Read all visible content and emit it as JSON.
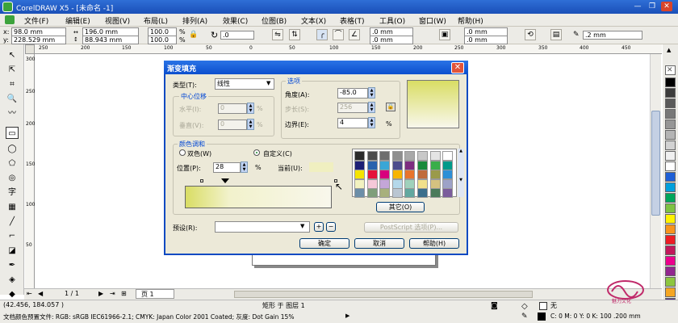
{
  "window": {
    "title": "CorelDRAW X5 - [未命名 -1]"
  },
  "menu": [
    "文件(F)",
    "编辑(E)",
    "视图(V)",
    "布局(L)",
    "排列(A)",
    "效果(C)",
    "位图(B)",
    "文本(X)",
    "表格(T)",
    "工具(O)",
    "窗口(W)",
    "帮助(H)"
  ],
  "propbar": {
    "x_label": "x:",
    "x": "98.0 mm",
    "y_label": "y:",
    "y": "228.529 mm",
    "w": "196.0 mm",
    "h": "88.943 mm",
    "sx": "100.0",
    "sy": "100.0",
    "pct": "%",
    "rot": ".0",
    "c1": ".0 mm",
    "c2": ".0 mm",
    "c3": ".0 mm",
    "c4": ".0 mm",
    "outline": ".2 mm"
  },
  "dialog": {
    "title": "渐变填充",
    "type_label": "类型(T):",
    "type_value": "线性",
    "options_label": "选项",
    "angle_label": "角度(A):",
    "angle": "-85.0",
    "steps_label": "步长(S):",
    "steps": "256",
    "edge_label": "边界(E):",
    "edge": "4",
    "pct": "%",
    "center_label": "中心位移",
    "hoz_label": "水平(I):",
    "hoz": "0",
    "vert_label": "垂直(V):",
    "vert": "0",
    "blend_label": "颜色调和",
    "two_color": "双色(W)",
    "custom": "自定义(C)",
    "position_label": "位置(P):",
    "position": "28",
    "current_label": "当前(U):",
    "others_btn": "其它(O)",
    "presets_label": "预设(R):",
    "postscript_btn": "PostScript 选项(P)...",
    "ok": "确定",
    "cancel": "取消",
    "help": "帮助(H)",
    "plus": "+",
    "minus": "−"
  },
  "colors": {
    "grad_start": "#d9dd64",
    "grad_end": "#f8f7ec",
    "dialog_bg": "#ece9d8",
    "title_blue": "#0b4fce",
    "grid": [
      "#2b2b2b",
      "#4c4c4c",
      "#6e6e6e",
      "#8e8e8e",
      "#a9a9a9",
      "#c8c8c8",
      "#e4e4e4",
      "#ffffff",
      "#1d1f76",
      "#2a62ae",
      "#3aa6d6",
      "#4c4c8c",
      "#7d2e80",
      "#1a8a3c",
      "#39ae49",
      "#009a8a",
      "#f5e400",
      "#e5133a",
      "#d8007d",
      "#f7b500",
      "#e8742c",
      "#c06b3a",
      "#9a9a4a",
      "#2d8fd6",
      "#f2f2c0",
      "#f5c8d8",
      "#c4a6d8",
      "#b4d8ea",
      "#9fd1bb",
      "#f1e08c",
      "#d5c280",
      "#9da2c8",
      "#6c8ea8",
      "#7e9e7a",
      "#a8b07c",
      "#bac6d2",
      "#62a8a0",
      "#3a6e8c",
      "#4b7a5a",
      "#7b5c9c"
    ],
    "palette": [
      "#000000",
      "#3c3c3c",
      "#5a5a5a",
      "#787878",
      "#969696",
      "#b4b4b4",
      "#d2d2d2",
      "#f0f0f0",
      "#ffffff",
      "#1e5fd6",
      "#00a0dc",
      "#00a65a",
      "#7ec242",
      "#fff200",
      "#f7941d",
      "#ed1c24",
      "#c2185b",
      "#ec008c",
      "#92278f",
      "#8dc63f",
      "#f5a623",
      "#4b2d83"
    ]
  },
  "nav": {
    "page_pos": "1 / 1",
    "page_tab": "页 1"
  },
  "status": {
    "coords": "(42.456, 184.057 )",
    "layer": "矩形 于 图层 1",
    "profile": "文档颜色预置文件: RGB: sRGB IEC61966-2.1; CMYK: Japan Color 2001 Coated; 灰度: Dot Gain 15%",
    "fill": "无",
    "outline": "C: 0 M: 0 Y: 0 K: 100  .200 mm"
  },
  "ruler": {
    "h": [
      "250",
      "200",
      "150",
      "100",
      "50",
      "0",
      "50",
      "100",
      "150",
      "200",
      "250",
      "300",
      "350",
      "400",
      "450"
    ],
    "v": [
      "300",
      "250",
      "200",
      "150",
      "100",
      "50"
    ]
  },
  "watermark": "魅力文化"
}
